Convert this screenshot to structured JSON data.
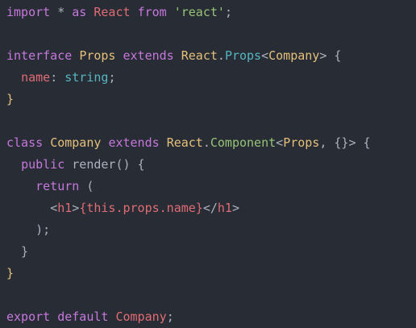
{
  "colors": {
    "background": "#282c34",
    "keyword": "#c678dd",
    "type": "#e5c07b",
    "string": "#98c379",
    "builtin_type": "#56b6c2",
    "property": "#e06c75",
    "function": "#61afef",
    "text": "#abb2bf",
    "punctuation": "#abb2bf"
  },
  "lines": [
    {
      "tokens": [
        {
          "text": "import",
          "kind": "keyword"
        },
        {
          "text": " * ",
          "kind": "text"
        },
        {
          "text": "as",
          "kind": "keyword"
        },
        {
          "text": " ",
          "kind": "text"
        },
        {
          "text": "React",
          "kind": "property"
        },
        {
          "text": " ",
          "kind": "text"
        },
        {
          "text": "from",
          "kind": "keyword"
        },
        {
          "text": " ",
          "kind": "text"
        },
        {
          "text": "'react'",
          "kind": "string"
        },
        {
          "text": ";",
          "kind": "punctuation"
        }
      ]
    },
    {
      "tokens": []
    },
    {
      "tokens": [
        {
          "text": "interface",
          "kind": "keyword"
        },
        {
          "text": " ",
          "kind": "text"
        },
        {
          "text": "Props",
          "kind": "type"
        },
        {
          "text": " ",
          "kind": "text"
        },
        {
          "text": "extends",
          "kind": "keyword"
        },
        {
          "text": " ",
          "kind": "text"
        },
        {
          "text": "React",
          "kind": "type"
        },
        {
          "text": ".",
          "kind": "punctuation"
        },
        {
          "text": "Props",
          "kind": "builtin_type"
        },
        {
          "text": "<",
          "kind": "punctuation"
        },
        {
          "text": "Company",
          "kind": "type"
        },
        {
          "text": "> {",
          "kind": "punctuation"
        }
      ]
    },
    {
      "tokens": [
        {
          "text": "  ",
          "kind": "text"
        },
        {
          "text": "name",
          "kind": "property"
        },
        {
          "text": ": ",
          "kind": "punctuation"
        },
        {
          "text": "string",
          "kind": "builtin_type"
        },
        {
          "text": ";",
          "kind": "punctuation"
        }
      ]
    },
    {
      "tokens": [
        {
          "text": "}",
          "kind": "type"
        }
      ]
    },
    {
      "tokens": []
    },
    {
      "tokens": [
        {
          "text": "class",
          "kind": "keyword"
        },
        {
          "text": " ",
          "kind": "text"
        },
        {
          "text": "Company",
          "kind": "type"
        },
        {
          "text": " ",
          "kind": "text"
        },
        {
          "text": "extends",
          "kind": "keyword"
        },
        {
          "text": " ",
          "kind": "text"
        },
        {
          "text": "React",
          "kind": "type"
        },
        {
          "text": ".",
          "kind": "punctuation"
        },
        {
          "text": "Component",
          "kind": "string"
        },
        {
          "text": "<",
          "kind": "punctuation"
        },
        {
          "text": "Props",
          "kind": "type"
        },
        {
          "text": ", {}> {",
          "kind": "punctuation"
        }
      ]
    },
    {
      "tokens": [
        {
          "text": "  ",
          "kind": "text"
        },
        {
          "text": "public",
          "kind": "keyword"
        },
        {
          "text": " render() {",
          "kind": "text"
        }
      ]
    },
    {
      "tokens": [
        {
          "text": "    ",
          "kind": "text"
        },
        {
          "text": "return",
          "kind": "keyword"
        },
        {
          "text": " (",
          "kind": "text"
        }
      ]
    },
    {
      "tokens": [
        {
          "text": "      ",
          "kind": "text"
        },
        {
          "text": "<",
          "kind": "punctuation"
        },
        {
          "text": "h1",
          "kind": "property"
        },
        {
          "text": ">",
          "kind": "punctuation"
        },
        {
          "text": "{this.props.name}",
          "kind": "property"
        },
        {
          "text": "</",
          "kind": "punctuation"
        },
        {
          "text": "h1",
          "kind": "property"
        },
        {
          "text": ">",
          "kind": "punctuation"
        }
      ]
    },
    {
      "tokens": [
        {
          "text": "    );",
          "kind": "text"
        }
      ]
    },
    {
      "tokens": [
        {
          "text": "  }",
          "kind": "text"
        }
      ]
    },
    {
      "tokens": [
        {
          "text": "}",
          "kind": "type"
        }
      ]
    },
    {
      "tokens": []
    },
    {
      "tokens": [
        {
          "text": "export",
          "kind": "keyword"
        },
        {
          "text": " ",
          "kind": "text"
        },
        {
          "text": "default",
          "kind": "keyword"
        },
        {
          "text": " ",
          "kind": "text"
        },
        {
          "text": "Company",
          "kind": "property"
        },
        {
          "text": ";",
          "kind": "punctuation"
        }
      ]
    }
  ]
}
